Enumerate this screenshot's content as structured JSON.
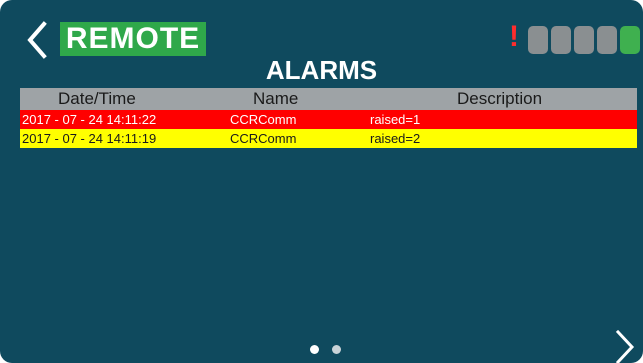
{
  "header": {
    "mode_label": "REMOTE",
    "alert_symbol": "!",
    "indicators": [
      {
        "state": "off",
        "color": "#8a8f91"
      },
      {
        "state": "off",
        "color": "#8a8f91"
      },
      {
        "state": "off",
        "color": "#8a8f91"
      },
      {
        "state": "off",
        "color": "#8a8f91"
      },
      {
        "state": "on",
        "color": "#3fb04f"
      }
    ]
  },
  "page": {
    "title": "ALARMS"
  },
  "alarm_table": {
    "columns": [
      "Date/Time",
      "Name",
      "Description"
    ],
    "rows": [
      {
        "datetime": "2017 - 07 - 24 14:11:22",
        "name": "CCRComm",
        "description": "raised=1",
        "bg_color": "#ff0000",
        "text_color": "#ffffff"
      },
      {
        "datetime": "2017 - 07 - 24 14:11:19",
        "name": "CCRComm",
        "description": "raised=2",
        "bg_color": "#ffff00",
        "text_color": "#1a1a1a"
      }
    ]
  },
  "pagination": {
    "current_page": 1,
    "total_pages": 2
  },
  "colors": {
    "background": "#0f4a5e",
    "accent": "#2fa84a",
    "alert": "#ff2d2d",
    "header_row": "#9ea3a6"
  },
  "icons": {
    "back": "chevron-left-icon",
    "next": "chevron-right-icon"
  }
}
